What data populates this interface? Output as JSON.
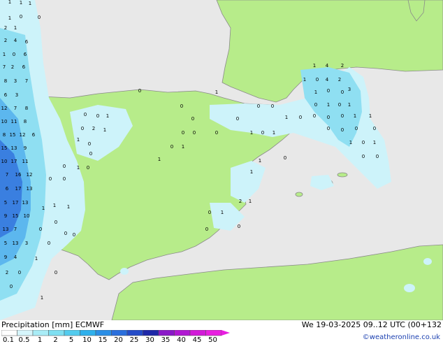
{
  "legend": {
    "title": "Precipitation [mm]",
    "model": "ECMWF",
    "datetime": "We 19-03-2025 09..12 UTC (00+132",
    "credit": "©weatheronline.co.uk",
    "ticks": [
      "0.1",
      "0.5",
      "1",
      "2",
      "5",
      "10",
      "15",
      "20",
      "25",
      "30",
      "35",
      "40",
      "45",
      "50"
    ],
    "colors": [
      "#fefefe",
      "#d6f5fb",
      "#a9ecf6",
      "#7fdff1",
      "#53ccee",
      "#2fb0ec",
      "#2a8ee6",
      "#2a6fdc",
      "#244cc8",
      "#1e28a8",
      "#8a18c8",
      "#b018d2",
      "#d21ad8",
      "#e81ee0"
    ]
  },
  "map": {
    "colors": {
      "sea": "#e8e8e8",
      "land": "#b7ec8a",
      "coast": "#8a8a8a",
      "light_rain": "#cdf3fa",
      "moderate_rain": "#8fdff2",
      "heavy_rain": "#5cb7ee",
      "very_heavy_rain": "#3a7fe0"
    },
    "labels": [
      "1",
      "1",
      "1",
      "1",
      "0",
      "0",
      "2",
      "1",
      "2",
      "4",
      "6",
      "1",
      "0",
      "6",
      "7",
      "2",
      "6",
      "8",
      "3",
      "7",
      "6",
      "3",
      "12",
      "7",
      "8",
      "10",
      "11",
      "8",
      "8",
      "15",
      "12",
      "6",
      "15",
      "13",
      "9",
      "10",
      "17",
      "11",
      "7",
      "16",
      "12",
      "6",
      "17",
      "13",
      "5",
      "17",
      "13",
      "9",
      "15",
      "10",
      "13",
      "7",
      "5",
      "13",
      "3",
      "9",
      "4",
      "2",
      "0",
      "0",
      "1",
      "0",
      "1",
      "0",
      "0",
      "0",
      "0",
      "0",
      "1",
      "1",
      "1",
      "0",
      "0",
      "0",
      "1",
      "0",
      "0",
      "1",
      "0",
      "0",
      "2",
      "1",
      "0",
      "0",
      "1",
      "0",
      "0",
      "0",
      "0",
      "0",
      "0",
      "1",
      "1",
      "1",
      "0",
      "0",
      "1",
      "0",
      "1",
      "1",
      "0",
      "0",
      "0",
      "0",
      "0",
      "0",
      "1",
      "1",
      "1",
      "0",
      "1",
      "2",
      "1",
      "0",
      "1",
      "0",
      "0",
      "1",
      "4",
      "2",
      "1",
      "0",
      "4",
      "2",
      "3",
      "1",
      "0",
      "0",
      "0",
      "1",
      "0",
      "1",
      "0",
      "0",
      "0",
      "0",
      "1",
      "0",
      "1",
      "0",
      "0"
    ]
  }
}
